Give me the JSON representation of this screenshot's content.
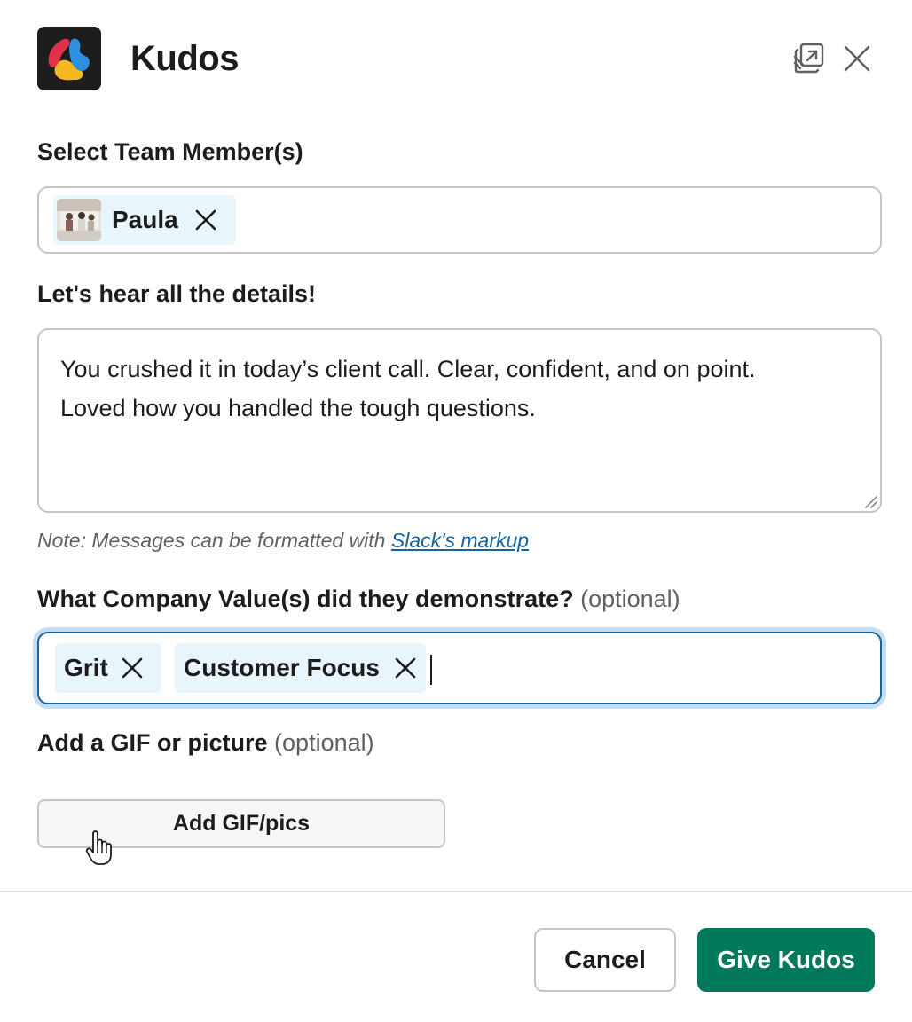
{
  "header": {
    "title": "Kudos",
    "logo_icon": "kudos-logo-icon",
    "popout_icon": "popout-window-icon",
    "close_icon": "close-icon"
  },
  "members": {
    "label": "Select Team Member(s)",
    "selected": [
      {
        "name": "Paula",
        "avatar_icon": "photo-avatar"
      }
    ]
  },
  "details": {
    "label": "Let's hear all the details!",
    "value_line1": "You crushed it in today’s client call. Clear, confident, and on point.",
    "value_line2": "Loved how you handled the tough questions.",
    "note_prefix": "Note: Messages can be formatted with ",
    "note_link": "Slack's markup"
  },
  "values": {
    "label": "What Company Value(s) did they demonstrate?",
    "optional": "(optional)",
    "selected": [
      "Grit",
      "Customer Focus"
    ]
  },
  "gif": {
    "label": "Add a GIF or picture",
    "optional": "(optional)",
    "button_label": "Add GIF/pics"
  },
  "footer": {
    "cancel_label": "Cancel",
    "submit_label": "Give Kudos"
  },
  "colors": {
    "accent_green": "#007a5a",
    "link_blue": "#1264a3",
    "chip_bg": "#e8f5fa",
    "focus_ring": "#c8dcec"
  }
}
